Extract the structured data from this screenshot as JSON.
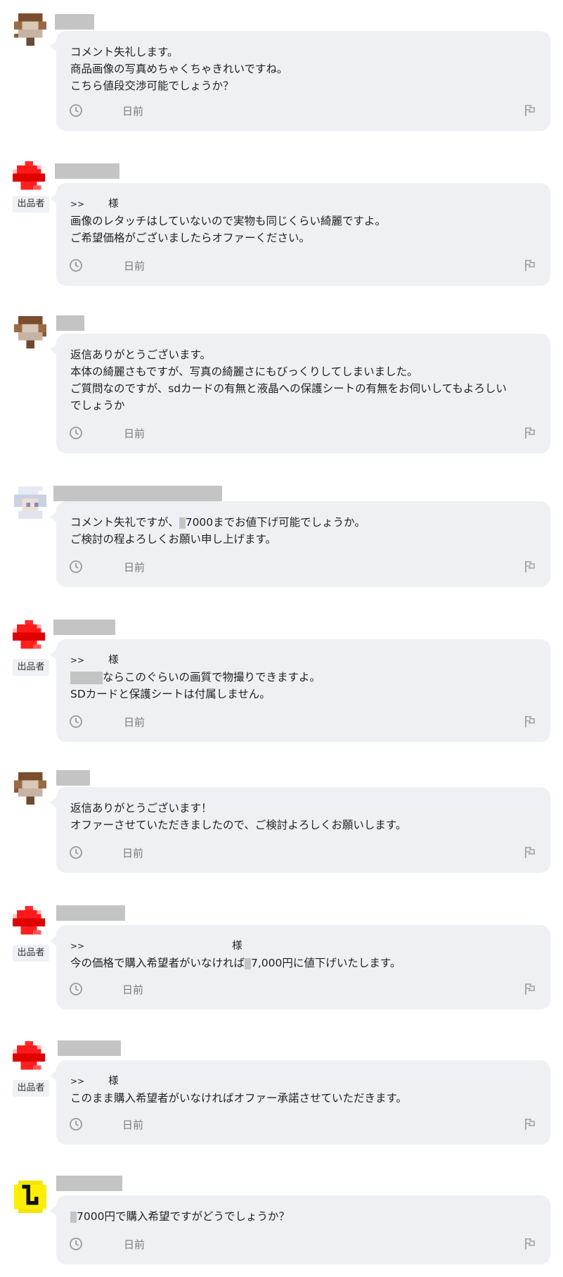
{
  "labels": {
    "seller_badge": "出品者",
    "reply_prefix": ">>",
    "honorific": "様",
    "time_suffix": "日前"
  },
  "comments": [
    {
      "id": "c1",
      "role": "buyer",
      "lines": [
        "コメント失礼します。",
        "商品画像の写真めちゃくちゃきれいですね。",
        "こちら値段交渉可能でしょうか？"
      ]
    },
    {
      "id": "c2",
      "role": "seller",
      "lines": [
        "画像のレタッチはしていないので実物も同じくらい綺麗ですよ。",
        "ご希望価格がございましたらオファーください。"
      ]
    },
    {
      "id": "c3",
      "role": "buyer",
      "lines": [
        "返信ありがとうございます。",
        "本体の綺麗さもですが、写真の綺麗さにもびっくりしてしまいました。",
        "ご質問なのですが、sdカードの有無と液晶への保護シートの有無をお伺いしてもよろしい",
        "でしょうか"
      ]
    },
    {
      "id": "c4",
      "role": "buyer",
      "line1_before": "コメント失礼ですが、",
      "line1_after": "7000までお値下げ可能でしょうか。",
      "lines": [
        "ご検討の程よろしくお願い申し上げます。"
      ]
    },
    {
      "id": "c5",
      "role": "seller",
      "line1_after": "ならこのぐらいの画質で物撮りできますよ。",
      "lines": [
        "SDカードと保護シートは付属しません。"
      ]
    },
    {
      "id": "c6",
      "role": "buyer",
      "lines": [
        "返信ありがとうございます！",
        "オファーさせていただきましたので、ご検討よろしくお願いします。"
      ]
    },
    {
      "id": "c7",
      "role": "seller",
      "line1_before": "今の価格で購入希望者がいなければ",
      "line1_after": "7,000円に値下げいたします。"
    },
    {
      "id": "c8",
      "role": "seller",
      "lines": [
        "このまま購入希望者がいなければオファー承諾させていただきます。"
      ]
    },
    {
      "id": "c9",
      "role": "buyer",
      "line1_after": "7000円で購入希望ですがどうでしょうか？"
    }
  ],
  "icons": {
    "clock": "clock-icon",
    "flag": "flag-icon",
    "avatar_brown": "avatar-pixel-brown",
    "avatar_red": "avatar-pixel-red",
    "avatar_white": "avatar-pixel-white",
    "avatar_yellow": "avatar-pixel-yellow"
  },
  "colors": {
    "bubble_bg": "#eff0f4",
    "mask": "#c4c4c4",
    "time_text": "#7a7a7a",
    "seller_badge_bg": "#eef1f5"
  }
}
